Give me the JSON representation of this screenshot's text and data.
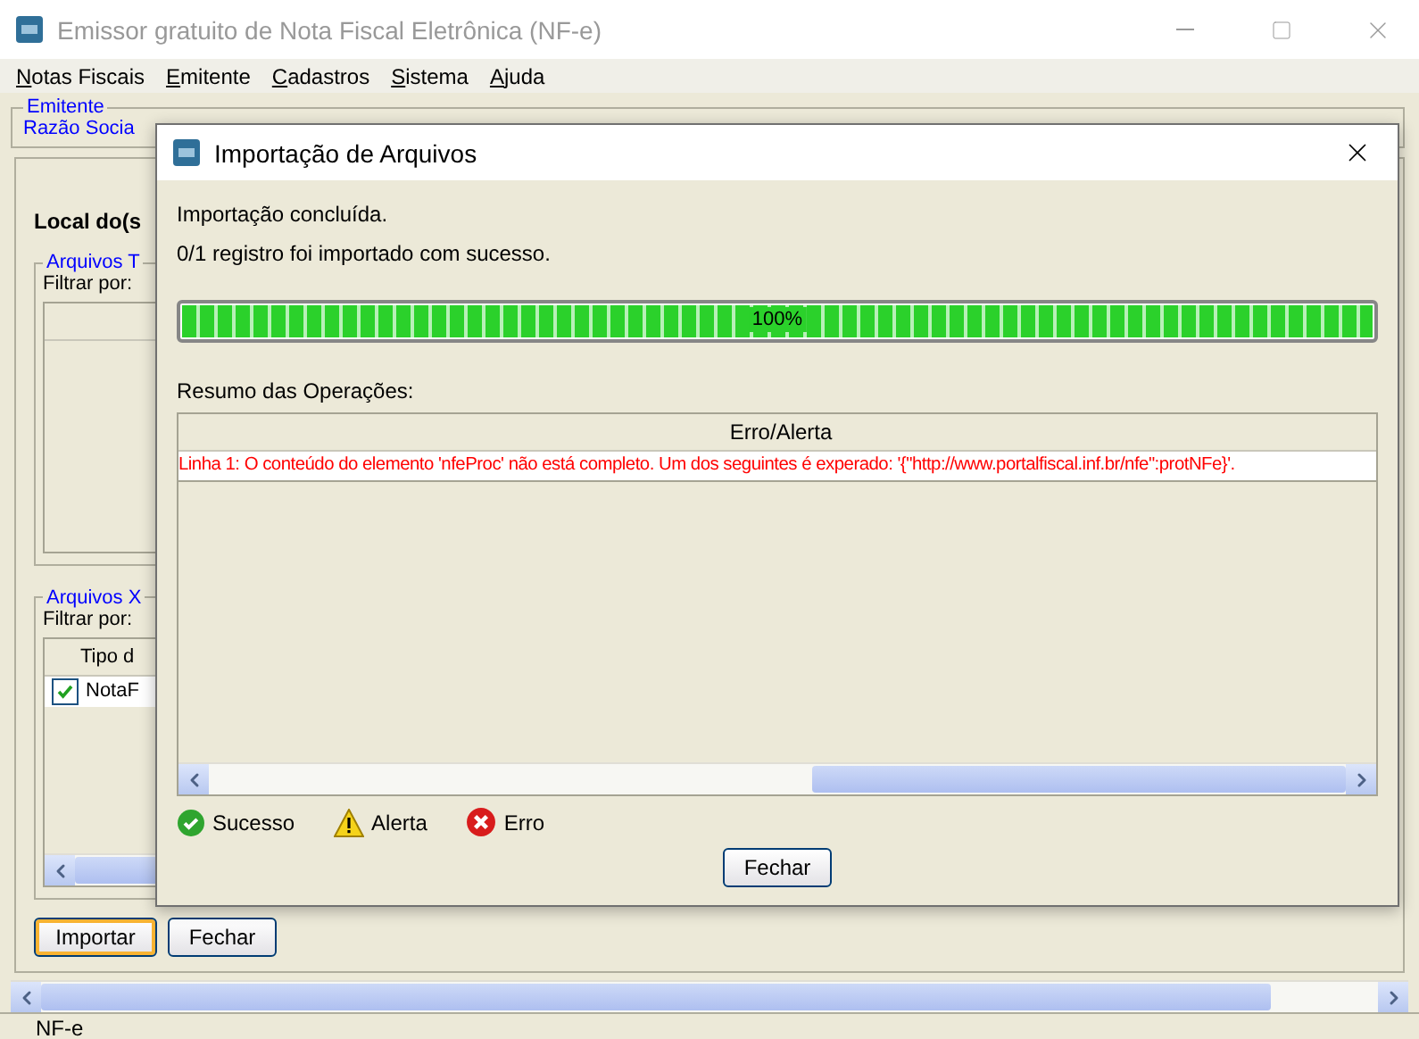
{
  "window": {
    "title": "Emissor gratuito de Nota Fiscal Eletrônica (NF-e)"
  },
  "menu": [
    "Notas Fiscais",
    "Emitente",
    "Cadastros",
    "Sistema",
    "Ajuda"
  ],
  "emitente": {
    "legend": "Emitente",
    "label": "Razão Socia"
  },
  "import_panel": {
    "heading": "Local do(s",
    "files_group": {
      "legend": "Arquivos T",
      "filter_label": "Filtrar por:"
    },
    "xml_group": {
      "legend": "Arquivos X",
      "filter_label": "Filtrar por:",
      "column": "Tipo d",
      "rows": [
        {
          "checked": true,
          "label": "NotaF"
        }
      ]
    },
    "buttons": [
      {
        "label": "Importar",
        "focused": true
      },
      {
        "label": "Fechar",
        "focused": false
      }
    ]
  },
  "status_bar": {
    "text": "NF-e"
  },
  "dialog": {
    "title": "Importação de Arquivos",
    "status": "Importação concluída.",
    "summary": "0/1 registro foi importado com sucesso.",
    "progress": {
      "level": 1,
      "reading": "100%"
    },
    "table_label": "Resumo das Operações:",
    "table": {
      "columns": [
        "Erro/Alerta"
      ],
      "rows": [
        {
          "kind": "error",
          "text": "Linha 1: O conteúdo do elemento 'nfeProc' não está completo. Um dos seguintes é experado: '{\"http://www.portalfiscal.inf.br/nfe\":protNFe}'."
        }
      ]
    },
    "legend": [
      {
        "kind": "success",
        "label": "Sucesso"
      },
      {
        "kind": "warning",
        "label": "Alerta"
      },
      {
        "kind": "error",
        "label": "Erro"
      }
    ],
    "close_button": "Fechar"
  }
}
